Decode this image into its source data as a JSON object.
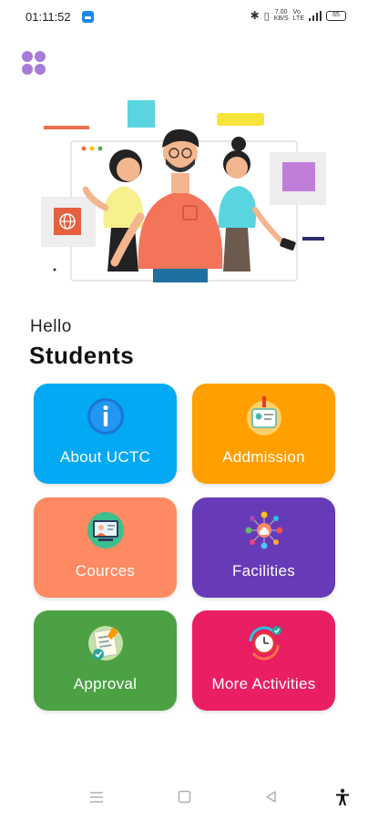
{
  "status_bar": {
    "time": "01:11:52",
    "network_speed": "7.00\nKB/S",
    "network_type": "Vo\nLTE",
    "battery": "65"
  },
  "greeting": {
    "hello": "Hello",
    "audience": "Students"
  },
  "cards": [
    {
      "label": "About UCTC",
      "color": "#04A9F4",
      "icon": "info-icon"
    },
    {
      "label": "Addmission",
      "color": "#FF9F00",
      "icon": "id-card-icon"
    },
    {
      "label": "Cources",
      "color": "#FD8A62",
      "icon": "online-class-icon"
    },
    {
      "label": "Facilities",
      "color": "#673AB7",
      "icon": "network-house-icon"
    },
    {
      "label": "Approval",
      "color": "#4CA145",
      "icon": "approved-document-icon"
    },
    {
      "label": "More Activities",
      "color": "#E91E63",
      "icon": "clock-refresh-icon"
    }
  ],
  "colors": {
    "menu_dots": "#A77BD9",
    "background": "#FFFFFF"
  }
}
